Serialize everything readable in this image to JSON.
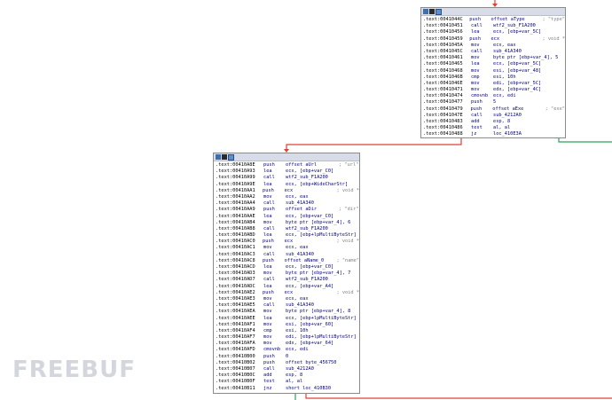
{
  "watermark": "FREEBUF",
  "colors": {
    "flow_true": "#2da05a",
    "flow_false": "#e0403a",
    "address": "#000000",
    "mnemonic": "#000080",
    "comment": "#808080"
  },
  "block_top": {
    "lines": [
      [
        ".text:0041044C",
        "push",
        "offset aType",
        "; \"type\""
      ],
      [
        ".text:00410451",
        "call",
        "wtf2_sub_F1A200",
        ""
      ],
      [
        ".text:00410456",
        "lea",
        "ecx, [ebp+var_5C]",
        ""
      ],
      [
        ".text:00410459",
        "push",
        "ecx",
        "; void *"
      ],
      [
        ".text:0041045A",
        "mov",
        "ecx, eax",
        ""
      ],
      [
        ".text:0041045C",
        "call",
        "sub_41A340",
        ""
      ],
      [
        ".text:00410461",
        "mov",
        "byte ptr [ebp+var_4], 5",
        ""
      ],
      [
        ".text:00410465",
        "lea",
        "ecx, [ebp+var_5C]",
        ""
      ],
      [
        ".text:00410468",
        "mov",
        "esi, [ebp+var_48]",
        ""
      ],
      [
        ".text:0041046B",
        "cmp",
        "esi, 10h",
        ""
      ],
      [
        ".text:0041046E",
        "mov",
        "edi, [ebp+var_5C]",
        ""
      ],
      [
        ".text:00410471",
        "mov",
        "edx, [ebp+var_4C]",
        ""
      ],
      [
        ".text:00410474",
        "cmovnb",
        "ecx, edi",
        ""
      ],
      [
        ".text:00410477",
        "push",
        "5",
        ""
      ],
      [
        ".text:00410479",
        "push",
        "offset aExe",
        "; \"exe\""
      ],
      [
        ".text:0041047E",
        "call",
        "sub_4212A0",
        ""
      ],
      [
        ".text:00410483",
        "add",
        "esp, 8",
        ""
      ],
      [
        ".text:00410486",
        "test",
        "al, al",
        ""
      ],
      [
        ".text:00410488",
        "jz",
        "loc_410E3A",
        ""
      ]
    ]
  },
  "block_bottom": {
    "lines": [
      [
        ".text:00410A8E",
        "push",
        "offset aUrl",
        "; \"url\""
      ],
      [
        ".text:00410A93",
        "lea",
        "ecx, [ebp+var_C0]",
        ""
      ],
      [
        ".text:00410A99",
        "call",
        "wtf2_sub_F1A200",
        ""
      ],
      [
        ".text:00410A9E",
        "lea",
        "ecx, [ebp+WideCharStr]",
        ""
      ],
      [
        ".text:00410AA1",
        "push",
        "ecx",
        "; void *"
      ],
      [
        ".text:00410AA2",
        "mov",
        "ecx, eax",
        ""
      ],
      [
        ".text:00410AA4",
        "call",
        "sub_41A340",
        ""
      ],
      [
        ".text:00410AA9",
        "push",
        "offset aDir",
        "; \"dir\""
      ],
      [
        ".text:00410AAE",
        "lea",
        "ecx, [ebp+var_C0]",
        ""
      ],
      [
        ".text:00410AB4",
        "mov",
        "byte ptr [ebp+var_4], 6",
        ""
      ],
      [
        ".text:00410AB8",
        "call",
        "wtf2_sub_F1A200",
        ""
      ],
      [
        ".text:00410ABD",
        "lea",
        "ecx, [ebp+lpMultiByteStr]",
        ""
      ],
      [
        ".text:00410AC0",
        "push",
        "ecx",
        "; void *"
      ],
      [
        ".text:00410AC1",
        "mov",
        "ecx, eax",
        ""
      ],
      [
        ".text:00410AC3",
        "call",
        "sub_41A340",
        ""
      ],
      [
        ".text:00410AC8",
        "push",
        "offset aName_0",
        "; \"name\""
      ],
      [
        ".text:00410ACD",
        "lea",
        "ecx, [ebp+var_C0]",
        ""
      ],
      [
        ".text:00410AD3",
        "mov",
        "byte ptr [ebp+var_4], 7",
        ""
      ],
      [
        ".text:00410AD7",
        "call",
        "wtf2_sub_F1A200",
        ""
      ],
      [
        ".text:00410ADC",
        "lea",
        "ecx, [ebp+var_A4]",
        ""
      ],
      [
        ".text:00410AE2",
        "push",
        "ecx",
        "; void *"
      ],
      [
        ".text:00410AE3",
        "mov",
        "ecx, eax",
        ""
      ],
      [
        ".text:00410AE5",
        "call",
        "sub_41A340",
        ""
      ],
      [
        ".text:00410AEA",
        "mov",
        "byte ptr [ebp+var_4], 8",
        ""
      ],
      [
        ".text:00410AEE",
        "lea",
        "ecx, [ebp+lpMultiByteStr]",
        ""
      ],
      [
        ".text:00410AF1",
        "mov",
        "esi, [ebp+var_60]",
        ""
      ],
      [
        ".text:00410AF4",
        "cmp",
        "esi, 10h",
        ""
      ],
      [
        ".text:00410AF7",
        "mov",
        "edi, [ebp+lpMultiByteStr]",
        ""
      ],
      [
        ".text:00410AFA",
        "mov",
        "edx, [ebp+var_64]",
        ""
      ],
      [
        ".text:00410AFD",
        "cmovnb",
        "ecx, edi",
        ""
      ],
      [
        ".text:00410B00",
        "push",
        "0",
        ""
      ],
      [
        ".text:00410B02",
        "push",
        "offset byte_456750",
        ""
      ],
      [
        ".text:00410B07",
        "call",
        "sub_4212A0",
        ""
      ],
      [
        ".text:00410B0C",
        "add",
        "esp, 8",
        ""
      ],
      [
        ".text:00410B0F",
        "test",
        "al, al",
        ""
      ],
      [
        ".text:00410B11",
        "jnz",
        "short loc_410B30",
        ""
      ]
    ]
  }
}
